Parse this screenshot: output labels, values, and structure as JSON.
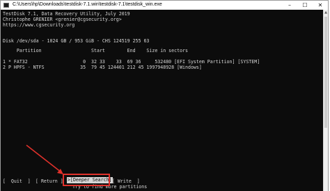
{
  "window": {
    "title": "C:\\Users\\hp\\Downloads\\testdisk-7.1.win\\testdisk-7.1\\testdisk_win.exe",
    "minimize": "–",
    "maximize": "☐",
    "close": "✕"
  },
  "console": {
    "header": [
      "TestDisk 7.1, Data Recovery Utility, July 2019",
      "Christophe GRENIER <grenier@cgsecurity.org>",
      "https://www.cgsecurity.org"
    ],
    "disk": "Disk /dev/sda - 1024 GB / 953 GiB - CHS 124519 255 63",
    "columns": "     Partition                  Start        End    Size in sectors",
    "partitions": [
      "1 * FAT32                    0  32 33    33  69 36     532480 [EFI System Partition] [SYSTEM]",
      "2 P HPFS - NTFS             35  79 45 124401 212 45 1997948928 [Windows]"
    ],
    "menu": {
      "quit": "[  Quit  ]",
      "return": "[ Return ]",
      "deeper_search": ">[Deeper Search]",
      "write": "[ Write  ]"
    },
    "hint": "Try to find more partitions"
  },
  "annotation": {
    "color": "#e0312b"
  }
}
